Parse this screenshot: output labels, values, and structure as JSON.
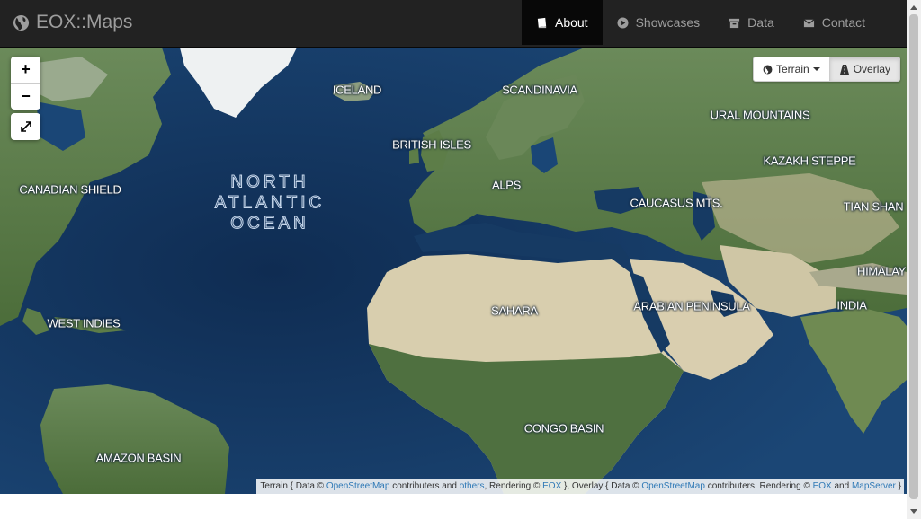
{
  "brand": {
    "title": "EOX::Maps",
    "icon": "globe-icon"
  },
  "nav": {
    "items": [
      {
        "label": "About",
        "icon": "book-icon",
        "active": true
      },
      {
        "label": "Showcases",
        "icon": "play-circle-icon",
        "active": false
      },
      {
        "label": "Data",
        "icon": "archive-icon",
        "active": false
      },
      {
        "label": "Contact",
        "icon": "envelope-icon",
        "active": false
      }
    ]
  },
  "map": {
    "zoom_in": "+",
    "zoom_out": "−",
    "ocean": [
      "NORTH",
      "ATLANTIC",
      "OCEAN"
    ],
    "labels": {
      "iceland": "ICELAND",
      "scandinavia": "SCANDINAVIA",
      "ural": "URAL MOUNTAINS",
      "british_isles": "BRITISH ISLES",
      "kazakh": "KAZAKH STEPPE",
      "canadian_shield": "CANADIAN SHIELD",
      "alps": "ALPS",
      "caucasus": "CAUCASUS MTS.",
      "tian_shan": "TIAN SHAN",
      "himalaya": "HIMALAY",
      "sahara": "SAHARA",
      "arabian": "ARABIAN PENINSULA",
      "india": "INDIA",
      "west_indies": "WEST INDIES",
      "congo": "CONGO BASIN",
      "amazon": "AMAZON BASIN"
    },
    "layer_switch": {
      "base_label": "Terrain",
      "overlay_label": "Overlay"
    },
    "attribution": {
      "t1": "Terrain { Data © ",
      "osm1": "OpenStreetMap",
      "t2": " contributers and ",
      "others": "others",
      "t3": ", Rendering © ",
      "eox1": "EOX",
      "t4": " }, Overlay { Data © ",
      "osm2": "OpenStreetMap",
      "t5": " contributers, Rendering © ",
      "eox2": "EOX",
      "t6": " and ",
      "mapserver": "MapServer",
      "t7": " }"
    }
  },
  "colors": {
    "navbar": "#222222",
    "nav_text": "#9d9d9d",
    "ocean": "#163a63",
    "land_green": "#4e6e3c",
    "desert": "#d9cfb0",
    "ice": "#f2f4f5",
    "link": "#2f79b6"
  }
}
